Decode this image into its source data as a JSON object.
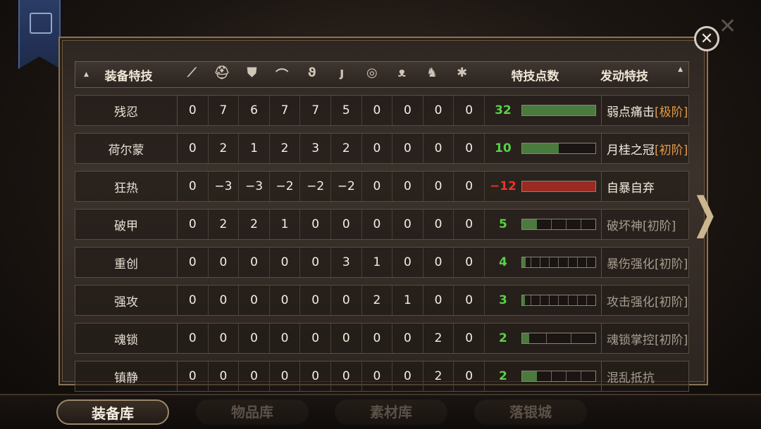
{
  "header": {
    "name_label": "装备特技",
    "points_label": "特技点数",
    "skill_label": "发动特技",
    "slot_icons": [
      "sword-icon",
      "helmet-icon",
      "armor-icon",
      "shoulder-icon",
      "bracer-icon",
      "boots-icon",
      "ring-icon",
      "mask-icon",
      "horse-icon",
      "charm-icon"
    ],
    "slot_glyphs": [
      "⟋",
      "⛑",
      "⛊",
      "⌒",
      "ϑ",
      "ȷ",
      "◎",
      "ᴥ",
      "♞",
      "✱"
    ]
  },
  "rows": [
    {
      "name": "残忍",
      "values": [
        "0",
        "7",
        "6",
        "7",
        "7",
        "5",
        "0",
        "0",
        "0",
        "0"
      ],
      "points": "32",
      "points_color": "green",
      "bar_type": "g",
      "bar_level": 5,
      "bar_segments": 5,
      "skill": "弱点痛击",
      "tier": "[极阶]",
      "active": true
    },
    {
      "name": "荷尔蒙",
      "values": [
        "0",
        "2",
        "1",
        "2",
        "3",
        "2",
        "0",
        "0",
        "0",
        "0"
      ],
      "points": "10",
      "points_color": "green",
      "bar_type": "g",
      "bar_level": 1,
      "bar_segments": 2,
      "skill": "月桂之冠",
      "tier": "[初阶]",
      "active": true
    },
    {
      "name": "狂热",
      "values": [
        "0",
        "−3",
        "−3",
        "−2",
        "−2",
        "−2",
        "0",
        "0",
        "0",
        "0"
      ],
      "points": "−12",
      "points_color": "red",
      "bar_type": "r",
      "bar_level": 1,
      "bar_segments": 1,
      "skill": "自暴自弃",
      "tier": "",
      "active": true
    },
    {
      "name": "破甲",
      "values": [
        "0",
        "2",
        "2",
        "1",
        "0",
        "0",
        "0",
        "0",
        "0",
        "0"
      ],
      "points": "5",
      "points_color": "green",
      "bar_type": "g",
      "bar_level": 1,
      "bar_segments": 5,
      "skill": "破坏神",
      "tier": "[初阶]",
      "active": false
    },
    {
      "name": "重创",
      "values": [
        "0",
        "0",
        "0",
        "0",
        "0",
        "3",
        "1",
        "0",
        "0",
        "0"
      ],
      "points": "4",
      "points_color": "green",
      "bar_type": "g",
      "bar_level": 0.4,
      "bar_segments": 8,
      "skill": "暴伤强化",
      "tier": "[初阶]",
      "active": false
    },
    {
      "name": "强攻",
      "values": [
        "0",
        "0",
        "0",
        "0",
        "0",
        "0",
        "2",
        "1",
        "0",
        "0"
      ],
      "points": "3",
      "points_color": "green",
      "bar_type": "g",
      "bar_level": 0.3,
      "bar_segments": 8,
      "skill": "攻击强化",
      "tier": "[初阶]",
      "active": false
    },
    {
      "name": "魂锁",
      "values": [
        "0",
        "0",
        "0",
        "0",
        "0",
        "0",
        "0",
        "0",
        "2",
        "0"
      ],
      "points": "2",
      "points_color": "green",
      "bar_type": "g",
      "bar_level": 0.3,
      "bar_segments": 3,
      "skill": "魂锁掌控",
      "tier": "[初阶]",
      "active": false
    },
    {
      "name": "镇静",
      "values": [
        "0",
        "0",
        "0",
        "0",
        "0",
        "0",
        "0",
        "0",
        "2",
        "0"
      ],
      "points": "2",
      "points_color": "green",
      "bar_type": "g",
      "bar_level": 1,
      "bar_segments": 5,
      "skill": "混乱抵抗",
      "tier": "",
      "active": false
    }
  ],
  "tabs": [
    {
      "label": "装备库",
      "active": true
    },
    {
      "label": "物品库",
      "active": false
    },
    {
      "label": "素材库",
      "active": false
    },
    {
      "label": "落银城",
      "active": false
    }
  ],
  "close_glyph": "✕",
  "next_glyph": "❯"
}
